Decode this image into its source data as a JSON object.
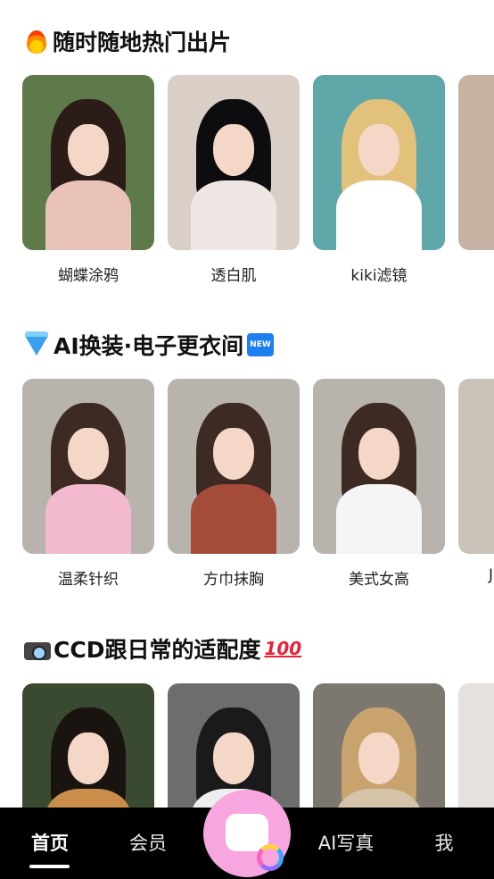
{
  "sections": [
    {
      "title": "随时随地热门出片",
      "icon": "fire-icon",
      "cards": [
        {
          "label": "蝴蝶涂鸦",
          "colors": {
            "bg": "#5e7a4a",
            "hair": "#2c1c17",
            "body": "#e9c2b8"
          }
        },
        {
          "label": "透白肌",
          "colors": {
            "bg": "#d9cfc7",
            "hair": "#0d0d10",
            "body": "#ede6e2"
          }
        },
        {
          "label": "kiki滤镜",
          "colors": {
            "bg": "#5fa7a8",
            "hair": "#e2c27a",
            "body": "#ffffff"
          }
        }
      ]
    },
    {
      "title": "AI换装·电子更衣间",
      "icon": "gem-icon",
      "badge": "NEW",
      "cards": [
        {
          "label": "温柔针织",
          "colors": {
            "bg": "#b8b4ad",
            "hair": "#3d2a22",
            "body": "#f3b9cf"
          }
        },
        {
          "label": "方巾抹胸",
          "colors": {
            "bg": "#b8b4ad",
            "hair": "#3d2a22",
            "body": "#a44b3a"
          }
        },
        {
          "label": "美式女高",
          "colors": {
            "bg": "#b8b4ad",
            "hair": "#3d2a22",
            "body": "#f5f5f5"
          }
        }
      ],
      "peek_label": "J"
    },
    {
      "title": "CCD跟日常的适配度",
      "icon": "camera-icon",
      "suffix": "100",
      "cards": [
        {
          "label": "",
          "colors": {
            "bg": "#3a4a30",
            "hair": "#1a1410",
            "body": "#c98f4a"
          }
        },
        {
          "label": "",
          "colors": {
            "bg": "#6d6d6d",
            "hair": "#1a1a1a",
            "body": "#eeeeee"
          }
        },
        {
          "label": "",
          "colors": {
            "bg": "#7c7870",
            "hair": "#c9a36e",
            "body": "#d4c3a8"
          }
        }
      ]
    }
  ],
  "tabbar": {
    "tabs": [
      "首页",
      "会员",
      "AI写真",
      "我"
    ],
    "active": "首页",
    "camera_icon": "camera-lens-icon",
    "accent": "#f7a6df"
  }
}
